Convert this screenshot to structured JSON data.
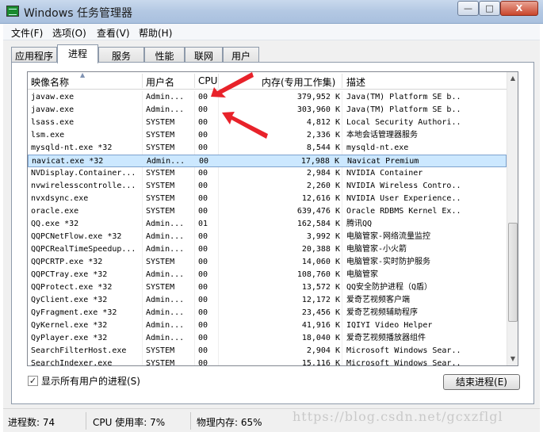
{
  "window": {
    "title": "Windows 任务管理器",
    "btn_min": "—",
    "btn_max": "□",
    "btn_close": "X"
  },
  "menu": [
    "文件(F)",
    "选项(O)",
    "查看(V)",
    "帮助(H)"
  ],
  "tabs": [
    "应用程序",
    "进程",
    "服务",
    "性能",
    "联网",
    "用户"
  ],
  "active_tab": "进程",
  "columns": {
    "name": "映像名称",
    "user": "用户名",
    "cpu": "CPU",
    "mem": "内存(专用工作集)",
    "desc": "描述"
  },
  "rows": [
    {
      "name": "javaw.exe",
      "user": "Admin...",
      "cpu": "00",
      "mem": "379,952 K",
      "desc": "Java(TM) Platform SE b..."
    },
    {
      "name": "javaw.exe",
      "user": "Admin...",
      "cpu": "00",
      "mem": "303,960 K",
      "desc": "Java(TM) Platform SE b..."
    },
    {
      "name": "lsass.exe",
      "user": "SYSTEM",
      "cpu": "00",
      "mem": "4,812 K",
      "desc": "Local Security Authori..."
    },
    {
      "name": "lsm.exe",
      "user": "SYSTEM",
      "cpu": "00",
      "mem": "2,336 K",
      "desc": "本地会话管理器服务"
    },
    {
      "name": "mysqld-nt.exe *32",
      "user": "SYSTEM",
      "cpu": "00",
      "mem": "8,544 K",
      "desc": "mysqld-nt.exe"
    },
    {
      "name": "navicat.exe *32",
      "user": "Admin...",
      "cpu": "00",
      "mem": "17,988 K",
      "desc": "Navicat Premium"
    },
    {
      "name": "NVDisplay.Container...",
      "user": "SYSTEM",
      "cpu": "00",
      "mem": "2,984 K",
      "desc": "NVIDIA Container"
    },
    {
      "name": "nvwirelesscontrolle...",
      "user": "SYSTEM",
      "cpu": "00",
      "mem": "2,260 K",
      "desc": "NVIDIA Wireless Contro..."
    },
    {
      "name": "nvxdsync.exe",
      "user": "SYSTEM",
      "cpu": "00",
      "mem": "12,616 K",
      "desc": "NVIDIA User Experience..."
    },
    {
      "name": "oracle.exe",
      "user": "SYSTEM",
      "cpu": "00",
      "mem": "639,476 K",
      "desc": "Oracle RDBMS Kernel Ex..."
    },
    {
      "name": "QQ.exe *32",
      "user": "Admin...",
      "cpu": "01",
      "mem": "162,584 K",
      "desc": "腾讯QQ"
    },
    {
      "name": "QQPCNetFlow.exe *32",
      "user": "Admin...",
      "cpu": "00",
      "mem": "3,992 K",
      "desc": "电脑管家-网络流量监控"
    },
    {
      "name": "QQPCRealTimeSpeedup...",
      "user": "Admin...",
      "cpu": "00",
      "mem": "20,388 K",
      "desc": "电脑管家-小火箭"
    },
    {
      "name": "QQPCRTP.exe *32",
      "user": "SYSTEM",
      "cpu": "00",
      "mem": "14,060 K",
      "desc": "电脑管家-实时防护服务"
    },
    {
      "name": "QQPCTray.exe *32",
      "user": "Admin...",
      "cpu": "00",
      "mem": "108,760 K",
      "desc": "电脑管家"
    },
    {
      "name": "QQProtect.exe *32",
      "user": "SYSTEM",
      "cpu": "00",
      "mem": "13,572 K",
      "desc": "QQ安全防护进程（Q盾）"
    },
    {
      "name": "QyClient.exe *32",
      "user": "Admin...",
      "cpu": "00",
      "mem": "12,172 K",
      "desc": "爱奇艺视频客户端"
    },
    {
      "name": "QyFragment.exe *32",
      "user": "Admin...",
      "cpu": "00",
      "mem": "23,456 K",
      "desc": "爱奇艺视频辅助程序"
    },
    {
      "name": "QyKernel.exe *32",
      "user": "Admin...",
      "cpu": "00",
      "mem": "41,916 K",
      "desc": "IQIYI Video Helper"
    },
    {
      "name": "QyPlayer.exe *32",
      "user": "Admin...",
      "cpu": "00",
      "mem": "18,040 K",
      "desc": "爱奇艺视频播放器组件"
    },
    {
      "name": "SearchFilterHost.exe",
      "user": "SYSTEM",
      "cpu": "00",
      "mem": "2,904 K",
      "desc": "Microsoft Windows Sear..."
    },
    {
      "name": "SearchIndexer.exe",
      "user": "SYSTEM",
      "cpu": "00",
      "mem": "15,116 K",
      "desc": "Microsoft Windows Sear..."
    }
  ],
  "selected_index": 5,
  "show_all_label": "显示所有用户的进程(S)",
  "show_all_checked": "✓",
  "end_process_label": "结束进程(E)",
  "status": {
    "processes": "进程数: 74",
    "cpu": "CPU 使用率: 7%",
    "memory": "物理内存: 65%"
  },
  "watermark": "https://blog.csdn.net/gcxzflgl",
  "colors": {
    "accent_arrow": "#e8222a",
    "selection": "#cce8ff"
  }
}
